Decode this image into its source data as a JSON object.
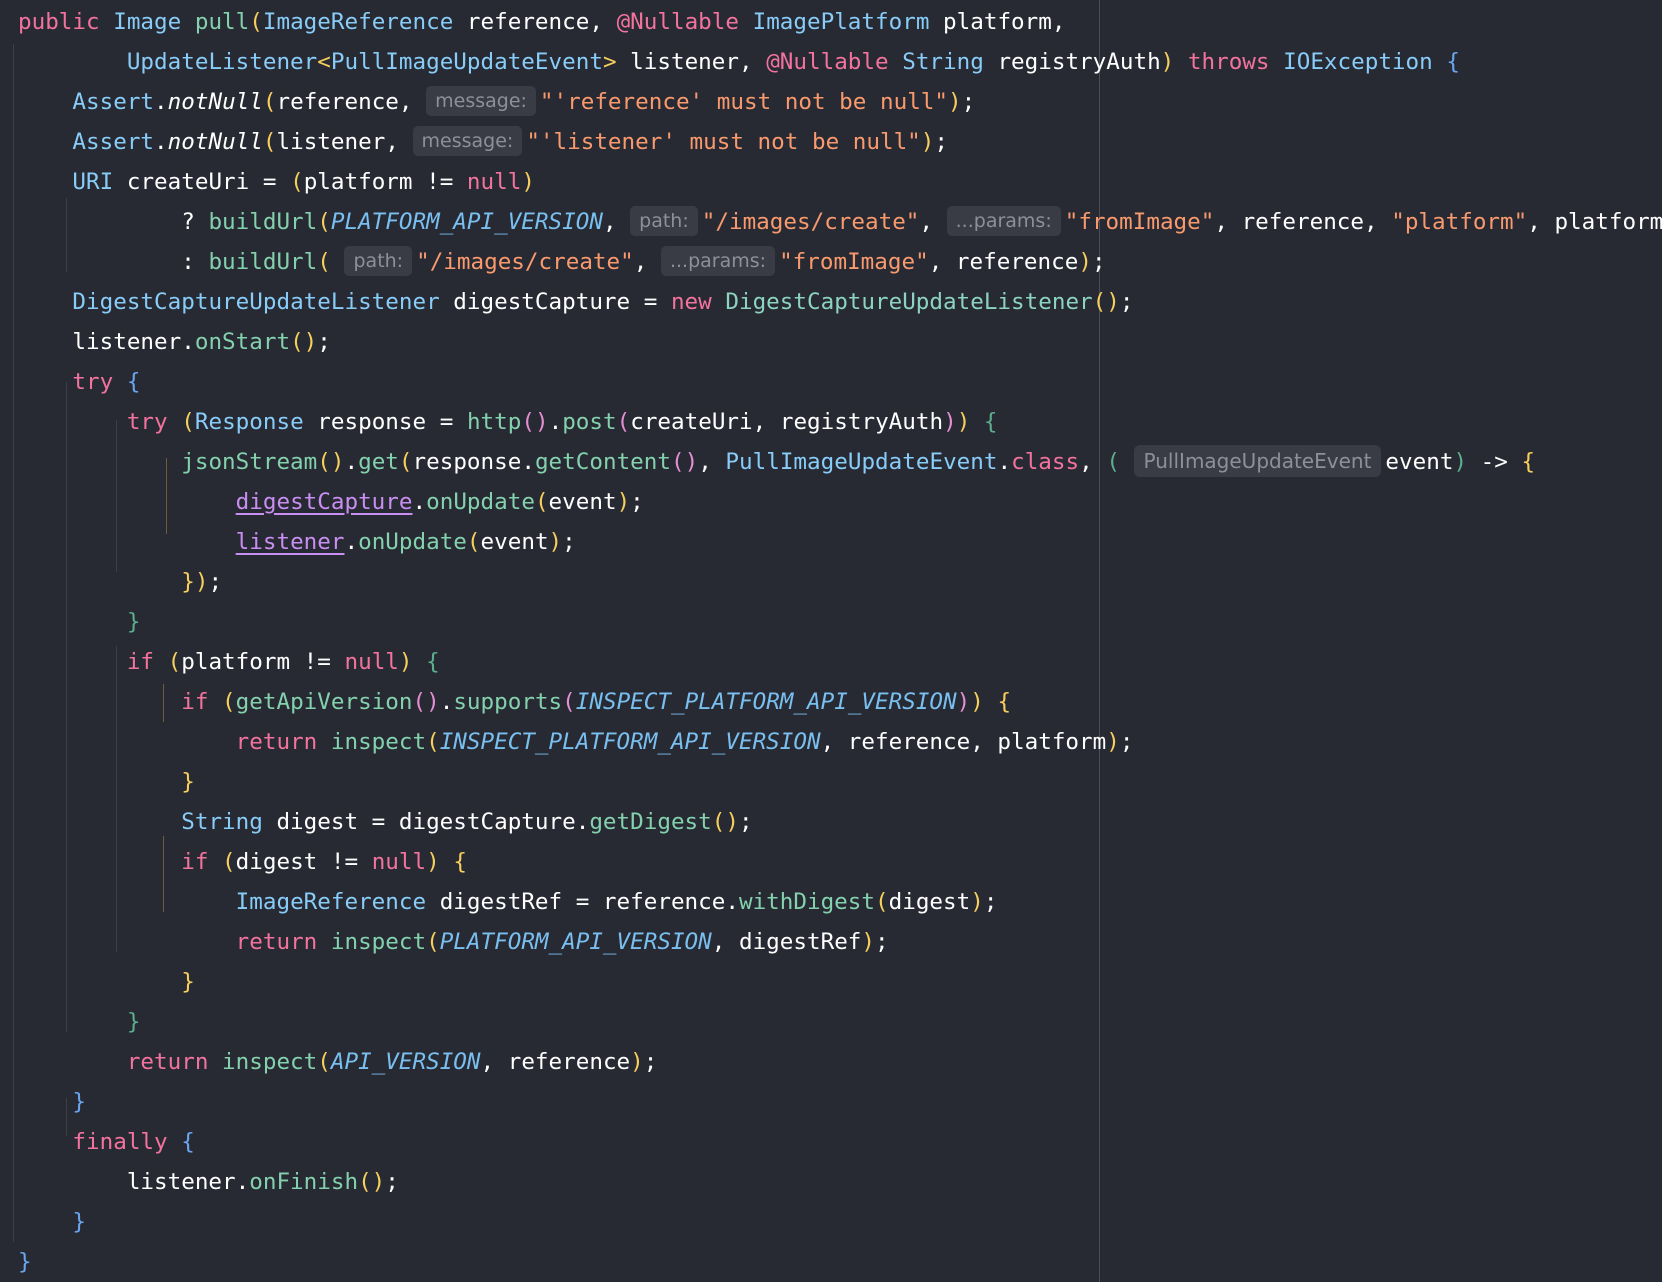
{
  "editor": {
    "language": "Java",
    "colors": {
      "background": "#282a33",
      "keyword": "#f2739d",
      "type": "#88ccf8",
      "method": "#84d1ad",
      "string": "#f99a6e",
      "constant": "#79bff0",
      "inlay_hint_background": "#393b45",
      "inlay_hint_text": "#8e9099"
    },
    "lines": [
      [
        [
          "kw",
          "public "
        ],
        [
          "ty",
          "Image "
        ],
        [
          "fn",
          "pull"
        ],
        [
          "p1",
          "("
        ],
        [
          "ty",
          "ImageReference "
        ],
        [
          "pl",
          "reference, "
        ],
        [
          "an",
          "@Nullable "
        ],
        [
          "ty",
          "ImagePlatform "
        ],
        [
          "pl",
          "platform,"
        ]
      ],
      [
        [
          "pl",
          "        "
        ],
        [
          "ty",
          "UpdateListener"
        ],
        [
          "p1",
          "<"
        ],
        [
          "ty",
          "PullImageUpdateEvent"
        ],
        [
          "p1",
          "> "
        ],
        [
          "pl",
          "listener, "
        ],
        [
          "an",
          "@Nullable "
        ],
        [
          "ty",
          "String "
        ],
        [
          "pl",
          "registryAuth"
        ],
        [
          "p1",
          ")"
        ],
        [
          "pl",
          " "
        ],
        [
          "kw",
          "throws "
        ],
        [
          "ty",
          "IOException "
        ],
        [
          "p3",
          "{"
        ]
      ],
      [
        [
          "pl",
          "    "
        ],
        [
          "ty",
          "Assert"
        ],
        [
          "pl",
          "."
        ],
        [
          "sf",
          "notNull"
        ],
        [
          "p1",
          "("
        ],
        [
          "pl",
          "reference, "
        ],
        [
          "hint",
          "message:"
        ],
        [
          "st",
          "\"'reference' must not be null\""
        ],
        [
          "p1",
          ")"
        ],
        [
          "pl",
          ";"
        ]
      ],
      [
        [
          "pl",
          "    "
        ],
        [
          "ty",
          "Assert"
        ],
        [
          "pl",
          "."
        ],
        [
          "sf",
          "notNull"
        ],
        [
          "p1",
          "("
        ],
        [
          "pl",
          "listener, "
        ],
        [
          "hint",
          "message:"
        ],
        [
          "st",
          "\"'listener' must not be null\""
        ],
        [
          "p1",
          ")"
        ],
        [
          "pl",
          ";"
        ]
      ],
      [
        [
          "pl",
          "    "
        ],
        [
          "ty",
          "URI "
        ],
        [
          "pl",
          "createUri = "
        ],
        [
          "p1",
          "("
        ],
        [
          "pl",
          "platform != "
        ],
        [
          "kw",
          "null"
        ],
        [
          "p1",
          ")"
        ]
      ],
      [
        [
          "pl",
          "            ? "
        ],
        [
          "fn",
          "buildUrl"
        ],
        [
          "p1",
          "("
        ],
        [
          "cn",
          "PLATFORM_API_VERSION"
        ],
        [
          "pl",
          ", "
        ],
        [
          "hint",
          "path:"
        ],
        [
          "st",
          "\"/images/create\""
        ],
        [
          "pl",
          ", "
        ],
        [
          "hint",
          "...params:"
        ],
        [
          "st",
          "\"fromImage\""
        ],
        [
          "pl",
          ", reference, "
        ],
        [
          "st",
          "\"platform\""
        ],
        [
          "pl",
          ", platform"
        ],
        [
          "p1",
          ")"
        ]
      ],
      [
        [
          "pl",
          "            : "
        ],
        [
          "fn",
          "buildUrl"
        ],
        [
          "p1",
          "( "
        ],
        [
          "hint",
          "path:"
        ],
        [
          "st",
          "\"/images/create\""
        ],
        [
          "pl",
          ", "
        ],
        [
          "hint",
          "...params:"
        ],
        [
          "st",
          "\"fromImage\""
        ],
        [
          "pl",
          ", reference"
        ],
        [
          "p1",
          ")"
        ],
        [
          "pl",
          ";"
        ]
      ],
      [
        [
          "pl",
          "    "
        ],
        [
          "ty",
          "DigestCaptureUpdateListener "
        ],
        [
          "pl",
          "digestCapture = "
        ],
        [
          "kw",
          "new "
        ],
        [
          "cf",
          "DigestCaptureUpdateListener"
        ],
        [
          "p1",
          "()"
        ],
        [
          "pl",
          ";"
        ]
      ],
      [
        [
          "pl",
          "    listener."
        ],
        [
          "fn",
          "onStart"
        ],
        [
          "p1",
          "()"
        ],
        [
          "pl",
          ";"
        ]
      ],
      [
        [
          "pl",
          "    "
        ],
        [
          "kw",
          "try "
        ],
        [
          "p3",
          "{"
        ]
      ],
      [
        [
          "pl",
          "        "
        ],
        [
          "kw",
          "try "
        ],
        [
          "p1",
          "("
        ],
        [
          "ty",
          "Response "
        ],
        [
          "pl",
          "response = "
        ],
        [
          "fn",
          "http"
        ],
        [
          "p2",
          "()"
        ],
        [
          "pl",
          "."
        ],
        [
          "fn",
          "post"
        ],
        [
          "p2",
          "("
        ],
        [
          "pl",
          "createUri, registryAuth"
        ],
        [
          "p2",
          ")"
        ],
        [
          "p1",
          ")"
        ],
        [
          "pl",
          " "
        ],
        [
          "p4",
          "{"
        ]
      ],
      [
        [
          "pl",
          "            "
        ],
        [
          "fn",
          "jsonStream"
        ],
        [
          "p1",
          "()"
        ],
        [
          "pl",
          "."
        ],
        [
          "fn",
          "get"
        ],
        [
          "p1",
          "("
        ],
        [
          "pl",
          "response."
        ],
        [
          "fn",
          "getContent"
        ],
        [
          "p2",
          "()"
        ],
        [
          "pl",
          ", "
        ],
        [
          "ty",
          "PullImageUpdateEvent"
        ],
        [
          "pl",
          "."
        ],
        [
          "kw",
          "class"
        ],
        [
          "pl",
          ", "
        ],
        [
          "p4",
          "( "
        ],
        [
          "hintt",
          "PullImageUpdateEvent"
        ],
        [
          "pl",
          "event"
        ],
        [
          "p4",
          ")"
        ],
        [
          "pl",
          " -> "
        ],
        [
          "p1",
          "{"
        ]
      ],
      [
        [
          "pl",
          "                "
        ],
        [
          "vu",
          "digestCapture"
        ],
        [
          "pl",
          "."
        ],
        [
          "fn",
          "onUpdate"
        ],
        [
          "p1",
          "("
        ],
        [
          "pl",
          "event"
        ],
        [
          "p1",
          ")"
        ],
        [
          "pl",
          ";"
        ]
      ],
      [
        [
          "pl",
          "                "
        ],
        [
          "vu",
          "listener"
        ],
        [
          "pl",
          "."
        ],
        [
          "fn",
          "onUpdate"
        ],
        [
          "p1",
          "("
        ],
        [
          "pl",
          "event"
        ],
        [
          "p1",
          ")"
        ],
        [
          "pl",
          ";"
        ]
      ],
      [
        [
          "pl",
          "            "
        ],
        [
          "p1",
          "})"
        ],
        [
          "pl",
          ";"
        ]
      ],
      [
        [
          "pl",
          "        "
        ],
        [
          "p4",
          "}"
        ]
      ],
      [
        [
          "pl",
          "        "
        ],
        [
          "kw",
          "if "
        ],
        [
          "p1",
          "("
        ],
        [
          "pl",
          "platform != "
        ],
        [
          "kw",
          "null"
        ],
        [
          "p1",
          ")"
        ],
        [
          "pl",
          " "
        ],
        [
          "p4",
          "{"
        ]
      ],
      [
        [
          "pl",
          "            "
        ],
        [
          "kw",
          "if "
        ],
        [
          "p1",
          "("
        ],
        [
          "fn",
          "getApiVersion"
        ],
        [
          "p2",
          "()"
        ],
        [
          "pl",
          "."
        ],
        [
          "fn",
          "supports"
        ],
        [
          "p2",
          "("
        ],
        [
          "cn",
          "INSPECT_PLATFORM_API_VERSION"
        ],
        [
          "p2",
          ")"
        ],
        [
          "p1",
          ")"
        ],
        [
          "pl",
          " "
        ],
        [
          "p1",
          "{"
        ]
      ],
      [
        [
          "pl",
          "                "
        ],
        [
          "kw",
          "return "
        ],
        [
          "fn",
          "inspect"
        ],
        [
          "p1",
          "("
        ],
        [
          "cn",
          "INSPECT_PLATFORM_API_VERSION"
        ],
        [
          "pl",
          ", reference, platform"
        ],
        [
          "p1",
          ")"
        ],
        [
          "pl",
          ";"
        ]
      ],
      [
        [
          "pl",
          "            "
        ],
        [
          "p1",
          "}"
        ]
      ],
      [
        [
          "pl",
          "            "
        ],
        [
          "ty",
          "String "
        ],
        [
          "pl",
          "digest = digestCapture."
        ],
        [
          "fn",
          "getDigest"
        ],
        [
          "p1",
          "()"
        ],
        [
          "pl",
          ";"
        ]
      ],
      [
        [
          "pl",
          "            "
        ],
        [
          "kw",
          "if "
        ],
        [
          "p1",
          "("
        ],
        [
          "pl",
          "digest != "
        ],
        [
          "kw",
          "null"
        ],
        [
          "p1",
          ")"
        ],
        [
          "pl",
          " "
        ],
        [
          "p1",
          "{"
        ]
      ],
      [
        [
          "pl",
          "                "
        ],
        [
          "ty",
          "ImageReference "
        ],
        [
          "pl",
          "digestRef = reference."
        ],
        [
          "fn",
          "withDigest"
        ],
        [
          "p1",
          "("
        ],
        [
          "pl",
          "digest"
        ],
        [
          "p1",
          ")"
        ],
        [
          "pl",
          ";"
        ]
      ],
      [
        [
          "pl",
          "                "
        ],
        [
          "kw",
          "return "
        ],
        [
          "fn",
          "inspect"
        ],
        [
          "p1",
          "("
        ],
        [
          "cn",
          "PLATFORM_API_VERSION"
        ],
        [
          "pl",
          ", digestRef"
        ],
        [
          "p1",
          ")"
        ],
        [
          "pl",
          ";"
        ]
      ],
      [
        [
          "pl",
          "            "
        ],
        [
          "p1",
          "}"
        ]
      ],
      [
        [
          "pl",
          "        "
        ],
        [
          "p4",
          "}"
        ]
      ],
      [
        [
          "pl",
          "        "
        ],
        [
          "kw",
          "return "
        ],
        [
          "fn",
          "inspect"
        ],
        [
          "p1",
          "("
        ],
        [
          "cn",
          "API_VERSION"
        ],
        [
          "pl",
          ", reference"
        ],
        [
          "p1",
          ")"
        ],
        [
          "pl",
          ";"
        ]
      ],
      [
        [
          "pl",
          "    "
        ],
        [
          "p3",
          "}"
        ]
      ],
      [
        [
          "pl",
          "    "
        ],
        [
          "kw",
          "finally "
        ],
        [
          "p3",
          "{"
        ]
      ],
      [
        [
          "pl",
          "        listener."
        ],
        [
          "fn",
          "onFinish"
        ],
        [
          "p1",
          "()"
        ],
        [
          "pl",
          ";"
        ]
      ],
      [
        [
          "pl",
          "    "
        ],
        [
          "p3",
          "}"
        ]
      ],
      [
        [
          "p3",
          "}"
        ]
      ]
    ]
  }
}
